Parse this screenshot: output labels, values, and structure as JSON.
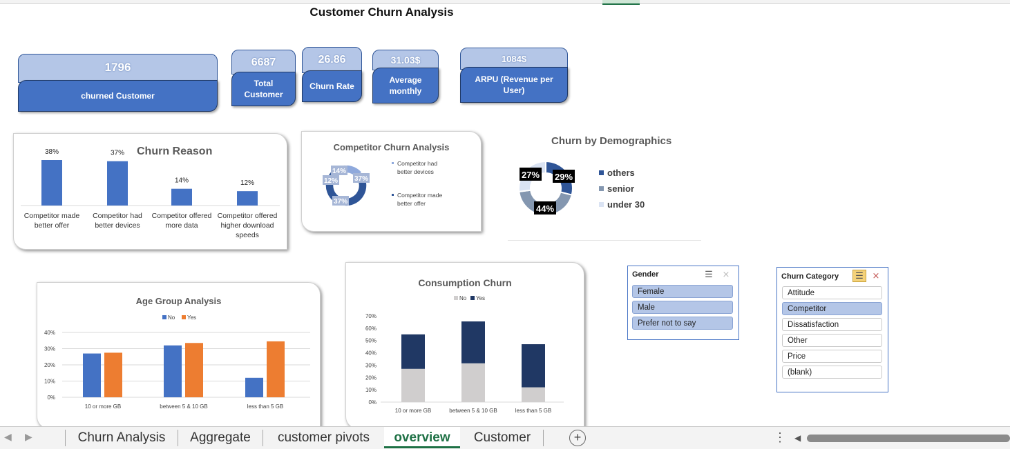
{
  "title": "Customer Churn Analysis",
  "kpis": {
    "churned": {
      "value": "1796",
      "label": "churned Customer"
    },
    "total": {
      "value": "6687",
      "label": "Total Customer"
    },
    "rate": {
      "value": "26.86",
      "label": "Churn Rate"
    },
    "avg": {
      "value": "31.03$",
      "label": "Average monthly"
    },
    "arpu": {
      "value": "1084$",
      "label": "ARPU (Revenue per User)"
    }
  },
  "churn_reason": {
    "title": "Churn Reason",
    "bars": [
      {
        "label": "38%",
        "cat": [
          "Competitor made",
          "better offer"
        ]
      },
      {
        "label": "37%",
        "cat": [
          "Competitor had",
          "better devices"
        ]
      },
      {
        "label": "14%",
        "cat": [
          "Competitor offered",
          "more data"
        ]
      },
      {
        "label": "12%",
        "cat": [
          "Competitor offered",
          "higher download",
          "speeds"
        ]
      }
    ]
  },
  "competitor": {
    "title": "Competitor Churn Analysis",
    "labels": [
      "14%",
      "37%",
      "37%",
      "12%"
    ],
    "legend": [
      "Competitor had better devices",
      "Competitor made better offer"
    ],
    "legend_lines": [
      [
        "Competitor had",
        "better devices"
      ],
      [
        "Competitor made",
        "better offer"
      ]
    ]
  },
  "demographics": {
    "title": "Churn by Demographics",
    "labels": [
      "29%",
      "44%",
      "27%"
    ],
    "legend": [
      "others",
      "senior",
      "under 30"
    ]
  },
  "age": {
    "title": "Age Group Analysis",
    "legend": [
      "No",
      "Yes"
    ],
    "yticks": [
      "40%",
      "30%",
      "20%",
      "10%",
      "0%"
    ],
    "categories": [
      "10 or more GB",
      "between 5 & 10 GB",
      "less than 5 GB"
    ]
  },
  "consumption": {
    "title": "Consumption Churn",
    "legend": [
      "No",
      "Yes"
    ],
    "yticks": [
      "70%",
      "60%",
      "50%",
      "40%",
      "30%",
      "20%",
      "10%",
      "0%"
    ],
    "categories": [
      "10 or more GB",
      "between 5 & 10 GB",
      "less than 5 GB"
    ]
  },
  "chart_data": [
    {
      "type": "bar",
      "title": "Churn Reason",
      "categories": [
        "Competitor made better offer",
        "Competitor had better devices",
        "Competitor offered more data",
        "Competitor offered higher download speeds"
      ],
      "values": [
        38,
        37,
        14,
        12
      ]
    },
    {
      "type": "pie",
      "title": "Competitor Churn Analysis",
      "categories": [
        "Competitor had better devices",
        "Competitor made better offer"
      ],
      "values": [
        14,
        37,
        37,
        12
      ]
    },
    {
      "type": "pie",
      "title": "Churn by Demographics",
      "categories": [
        "others",
        "senior",
        "under 30"
      ],
      "values": [
        29,
        44,
        27
      ]
    },
    {
      "type": "bar",
      "title": "Age Group Analysis",
      "categories": [
        "10 or more GB",
        "between 5 & 10 GB",
        "less than 5 GB"
      ],
      "series": [
        {
          "name": "No",
          "values": [
            27,
            32,
            12
          ]
        },
        {
          "name": "Yes",
          "values": [
            27.5,
            33.5,
            34.5
          ]
        }
      ],
      "ylim": [
        0,
        40
      ]
    },
    {
      "type": "bar",
      "title": "Consumption Churn",
      "categories": [
        "10 or more GB",
        "between 5 & 10 GB",
        "less than 5 GB"
      ],
      "series": [
        {
          "name": "No",
          "values": [
            27,
            31.5,
            12
          ]
        },
        {
          "name": "Yes",
          "values": [
            28,
            34,
            35
          ]
        }
      ],
      "ylim": [
        0,
        70
      ]
    }
  ],
  "colors": {
    "blue": "#4472c4",
    "orange": "#ed7d31",
    "navy": "#203864",
    "grey": "#d0cece",
    "light": "#b4c6e7"
  },
  "gender_slicer": {
    "header": "Gender",
    "items": [
      "Female",
      "Male",
      "Prefer not to say"
    ]
  },
  "category_slicer": {
    "header": "Churn Category",
    "items": [
      "Attitude",
      "Competitor",
      "Dissatisfaction",
      "Other",
      "Price",
      "(blank)"
    ]
  },
  "tabs": [
    "Churn Analysis",
    "Aggregate",
    "customer pivots",
    "overview",
    "Customer"
  ],
  "active_tab": "overview"
}
